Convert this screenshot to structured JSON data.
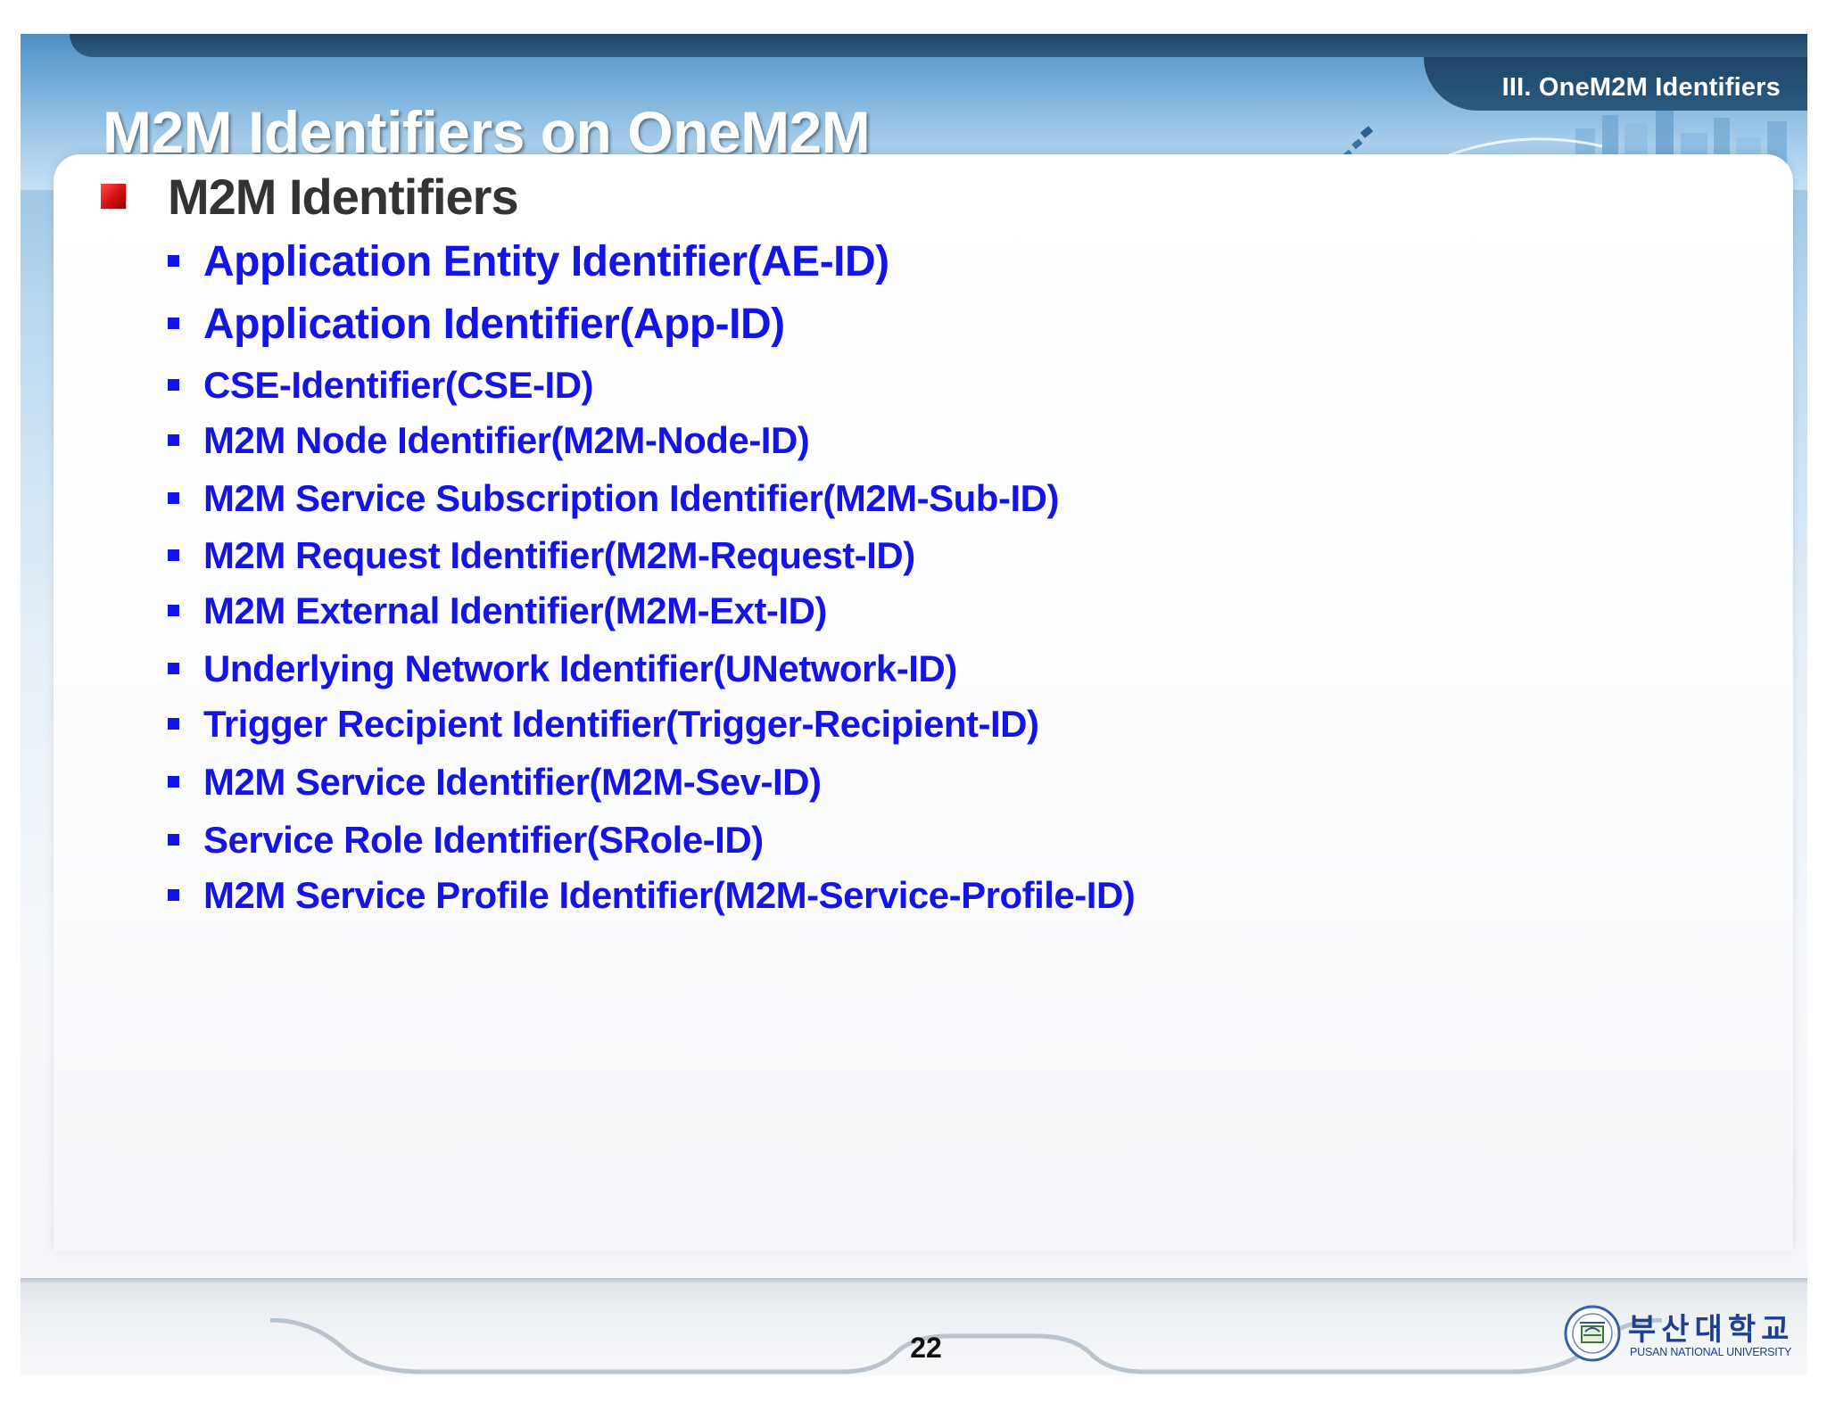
{
  "header": {
    "title": "M2M Identifiers on OneM2M",
    "section_label": "III. OneM2M Identifiers"
  },
  "content": {
    "heading": "M2M Identifiers",
    "items": [
      "Application Entity Identifier(AE-ID)",
      "Application Identifier(App-ID)",
      "CSE-Identifier(CSE-ID)",
      "M2M Node Identifier(M2M-Node-ID)",
      "M2M Service Subscription Identifier(M2M-Sub-ID)",
      "M2M Request Identifier(M2M-Request-ID)",
      "M2M External Identifier(M2M-Ext-ID)",
      "Underlying Network Identifier(UNetwork-ID)",
      "Trigger Recipient Identifier(Trigger-Recipient-ID)",
      "M2M Service Identifier(M2M-Sev-ID)",
      "Service Role Identifier(SRole-ID)",
      "M2M Service Profile Identifier(M2M-Service-Profile-ID)"
    ]
  },
  "footer": {
    "page_number": "22",
    "university_korean": "부산대학교",
    "university_english": "PUSAN NATIONAL UNIVERSITY"
  },
  "colors": {
    "item_text": "#1414e6",
    "heading_text": "#333333",
    "bullet_red": "#d21010",
    "header_dark": "#1e4566"
  },
  "icons": {
    "heading_bullet": "red-square-bullet-icon",
    "item_bullet": "blue-square-bullet-icon",
    "logo": "university-seal-icon"
  }
}
